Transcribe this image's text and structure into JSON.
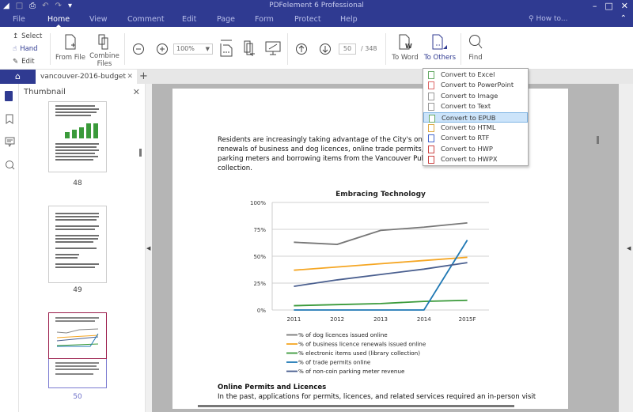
{
  "titlebar": {
    "title": "PDFelement 6 Professional"
  },
  "menu": {
    "tabs": [
      "File",
      "Home",
      "View",
      "Comment",
      "Edit",
      "Page",
      "Form",
      "Protect",
      "Help"
    ],
    "active": "Home",
    "howto": "How to..."
  },
  "ribbon": {
    "modes": [
      "Select",
      "Hand",
      "Edit"
    ],
    "from_file": "From File",
    "combine": "Combine Files",
    "zoom_value": "100%",
    "page_current": "50",
    "page_total": "/ 348",
    "to_word": "To Word",
    "to_others": "To Others",
    "find": "Find"
  },
  "tabs": {
    "doc": "vancouver-2016-budget"
  },
  "thumbnail": {
    "title": "Thumbnail",
    "pages": [
      "48",
      "49",
      "50"
    ],
    "current": "50"
  },
  "dropdown": {
    "items": [
      "Convert to Excel",
      "Convert to PowerPoint",
      "Convert to Image",
      "Convert to Text",
      "Convert to EPUB",
      "Convert to HTML",
      "Convert to RTF",
      "Convert to HWP",
      "Convert to HWPX"
    ],
    "selected": "Convert to EPUB"
  },
  "doc": {
    "para1": [
      "Residents are increasingly taking advantage of the City's online",
      "renewals of business and dog licences, online trade permits, ma",
      "parking meters and borrowing items from the Vancouver Public l",
      "collection."
    ],
    "heading2": "Online Permits and Licences",
    "para2": "In the past, applications for permits, licences, and related services required an in-person visit"
  },
  "chart_data": {
    "type": "line",
    "title": "Embracing Technology",
    "categories": [
      "2011",
      "2012",
      "2013",
      "2014",
      "2015F"
    ],
    "ylim": [
      0,
      100
    ],
    "yticks": [
      "0%",
      "25%",
      "50%",
      "75%",
      "100%"
    ],
    "grid": true,
    "legend_position": "bottom",
    "series": [
      {
        "name": "% of dog licences issued online",
        "color": "#777777",
        "values": [
          63,
          61,
          74,
          77,
          81
        ]
      },
      {
        "name": "% of business licence renewals issued online",
        "color": "#f5a623",
        "values": [
          37,
          40,
          43,
          46,
          49
        ]
      },
      {
        "name": "% electronic items used (library collection)",
        "color": "#3a9a3a",
        "values": [
          4,
          5,
          6,
          8,
          9
        ]
      },
      {
        "name": "% of trade permits online",
        "color": "#1f78b4",
        "values": [
          0,
          0,
          0,
          0,
          65
        ]
      },
      {
        "name": "% of non-coin parking meter revenue",
        "color": "#4a5f8f",
        "values": [
          22,
          28,
          33,
          38,
          44
        ]
      }
    ]
  }
}
